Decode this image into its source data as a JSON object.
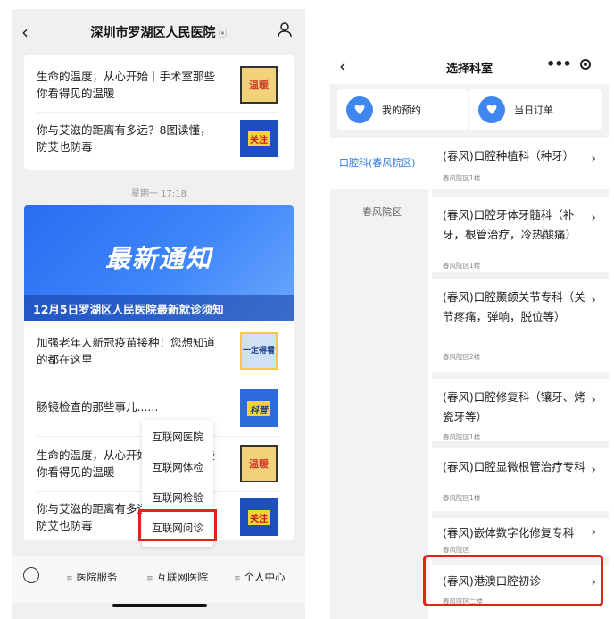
{
  "left": {
    "nav": {
      "title": "深圳市罗湖区人民医院",
      "title_mark": "⦿"
    },
    "card1_items": [
      {
        "title": "生命的温度，从心开始｜手术室那些你看得见的温暖",
        "thumb": "温暖"
      },
      {
        "title": "你与艾滋的距离有多远？8图读懂，防艾也防毒",
        "thumb": "关注"
      }
    ],
    "timestamp": "星期一 17:18",
    "banner": {
      "big": "最新通知",
      "caption": "12月5日罗湖区人民医院最新就诊须知"
    },
    "card2_items": [
      {
        "title": "加强老年人新冠疫苗接种！您想知道的都在这里",
        "thumb": "一定得看"
      },
      {
        "title": "肠镜检查的那些事儿......",
        "thumb": "科普"
      },
      {
        "title": "生命的温度，从心开始｜手术室那些你看得见的温暖",
        "thumb": "温暖"
      },
      {
        "title": "你与艾滋的距离有多远？8图读懂，防艾也防毒",
        "thumb": "关注"
      }
    ],
    "popup_menu": [
      "互联网医院",
      "互联网体检",
      "互联网检验",
      "互联网问诊"
    ],
    "tabs": [
      "医院服务",
      "互联网医院",
      "个人中心"
    ]
  },
  "right": {
    "nav": {
      "title": "选择科室"
    },
    "quick": [
      "我的预约",
      "当日订单"
    ],
    "side_items": [
      "口腔科(春风院区)",
      "春风院区"
    ],
    "departments": [
      {
        "name": "(春风)口腔种植科（种牙）",
        "campus": "春风院区1楼"
      },
      {
        "name": "(春风)口腔牙体牙髓科（补牙，根管治疗，冷热酸痛）",
        "campus": "春风院区1楼"
      },
      {
        "name": "(春风)口腔颞颌关节专科（关节疼痛，弹响，脱位等）",
        "campus": "春风院区2楼"
      },
      {
        "name": "(春风)口腔修复科（镶牙、烤瓷牙等）",
        "campus": "春风院区1楼"
      },
      {
        "name": "(春风)口腔显微根管治疗专科",
        "campus": "春风院区1楼"
      },
      {
        "name": "(春风)嵌体数字化修复专科",
        "campus": "春风院区"
      },
      {
        "name": "(春风)港澳口腔初诊",
        "campus": "春风院区二楼"
      }
    ]
  },
  "colors": {
    "accent": "#2a7ae2",
    "highlight": "#e2231a",
    "banner": "#3f86fb"
  }
}
